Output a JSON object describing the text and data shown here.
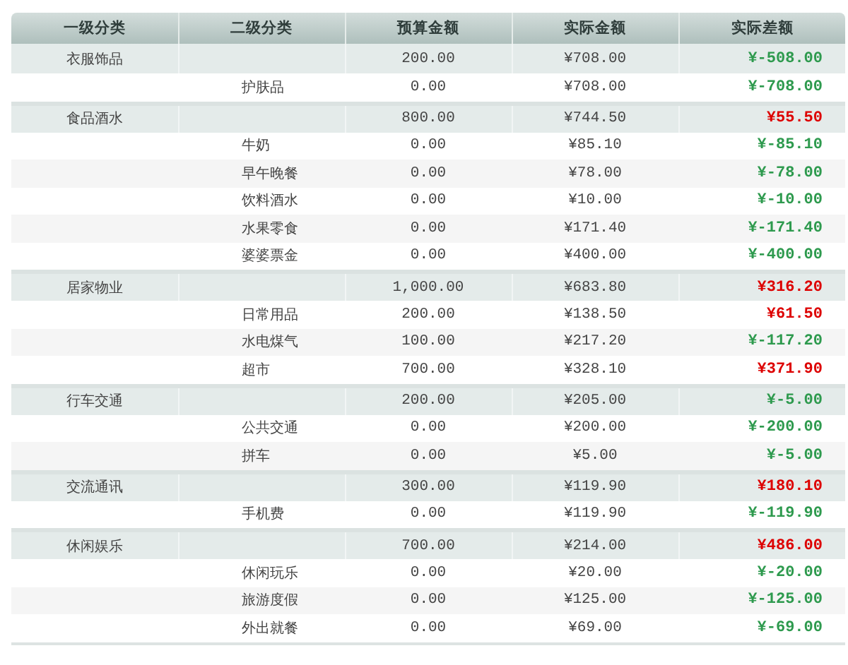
{
  "table": {
    "columns": [
      "一级分类",
      "二级分类",
      "预算金额",
      "实际金额",
      "实际差额"
    ],
    "groups": [
      {
        "category": "衣服饰品",
        "budget": "200.00",
        "actual": "¥708.00",
        "difference": "¥-508.00",
        "color": "#2e9a4e",
        "children": [
          {
            "category": "护肤品",
            "budget": "0.00",
            "actual": "¥708.00",
            "difference": "¥-708.00",
            "color": "#2e9a4e"
          }
        ]
      },
      {
        "category": "食品酒水",
        "budget": "800.00",
        "actual": "¥744.50",
        "difference": "¥55.50",
        "color": "#dd0000",
        "children": [
          {
            "category": "牛奶",
            "budget": "0.00",
            "actual": "¥85.10",
            "difference": "¥-85.10",
            "color": "#2e9a4e"
          },
          {
            "category": "早午晚餐",
            "budget": "0.00",
            "actual": "¥78.00",
            "difference": "¥-78.00",
            "color": "#2e9a4e"
          },
          {
            "category": "饮料酒水",
            "budget": "0.00",
            "actual": "¥10.00",
            "difference": "¥-10.00",
            "color": "#2e9a4e"
          },
          {
            "category": "水果零食",
            "budget": "0.00",
            "actual": "¥171.40",
            "difference": "¥-171.40",
            "color": "#2e9a4e"
          },
          {
            "category": "婆婆票金",
            "budget": "0.00",
            "actual": "¥400.00",
            "difference": "¥-400.00",
            "color": "#2e9a4e"
          }
        ]
      },
      {
        "category": "居家物业",
        "budget": "1,000.00",
        "actual": "¥683.80",
        "difference": "¥316.20",
        "color": "#dd0000",
        "children": [
          {
            "category": "日常用品",
            "budget": "200.00",
            "actual": "¥138.50",
            "difference": "¥61.50",
            "color": "#dd0000"
          },
          {
            "category": "水电煤气",
            "budget": "100.00",
            "actual": "¥217.20",
            "difference": "¥-117.20",
            "color": "#2e9a4e"
          },
          {
            "category": "超市",
            "budget": "700.00",
            "actual": "¥328.10",
            "difference": "¥371.90",
            "color": "#dd0000"
          }
        ]
      },
      {
        "category": "行车交通",
        "budget": "200.00",
        "actual": "¥205.00",
        "difference": "¥-5.00",
        "color": "#2e9a4e",
        "children": [
          {
            "category": "公共交通",
            "budget": "0.00",
            "actual": "¥200.00",
            "difference": "¥-200.00",
            "color": "#2e9a4e"
          },
          {
            "category": "拼车",
            "budget": "0.00",
            "actual": "¥5.00",
            "difference": "¥-5.00",
            "color": "#2e9a4e"
          }
        ]
      },
      {
        "category": "交流通讯",
        "budget": "300.00",
        "actual": "¥119.90",
        "difference": "¥180.10",
        "color": "#dd0000",
        "children": [
          {
            "category": "手机费",
            "budget": "0.00",
            "actual": "¥119.90",
            "difference": "¥-119.90",
            "color": "#2e9a4e"
          }
        ]
      },
      {
        "category": "休闲娱乐",
        "budget": "700.00",
        "actual": "¥214.00",
        "difference": "¥486.00",
        "color": "#dd0000",
        "children": [
          {
            "category": "休闲玩乐",
            "budget": "0.00",
            "actual": "¥20.00",
            "difference": "¥-20.00",
            "color": "#2e9a4e"
          },
          {
            "category": "旅游度假",
            "budget": "0.00",
            "actual": "¥125.00",
            "difference": "¥-125.00",
            "color": "#2e9a4e"
          },
          {
            "category": "外出就餐",
            "budget": "0.00",
            "actual": "¥69.00",
            "difference": "¥-69.00",
            "color": "#2e9a4e"
          }
        ]
      }
    ]
  }
}
